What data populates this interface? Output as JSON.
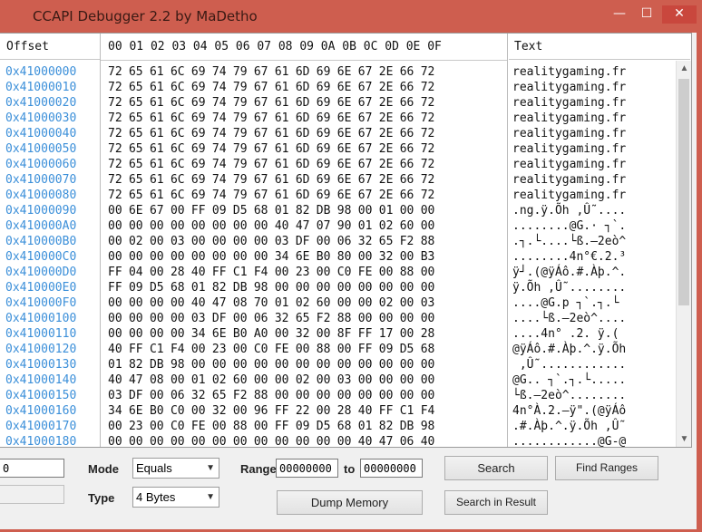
{
  "window": {
    "title": "CCAPI Debugger 2.2 by MaDetho",
    "minimize": "—",
    "maximize": "☐",
    "close": "✕"
  },
  "hex_view": {
    "headers": {
      "offset": "Offset",
      "bytes": "00 01 02 03 04 05 06 07 08 09 0A 0B 0C 0D 0E 0F",
      "text": "Text"
    },
    "rows": [
      {
        "offset": "0x41000000",
        "bytes": "72 65 61 6C 69 74 79 67 61 6D 69 6E 67 2E 66 72",
        "text": "realitygaming.fr"
      },
      {
        "offset": "0x41000010",
        "bytes": "72 65 61 6C 69 74 79 67 61 6D 69 6E 67 2E 66 72",
        "text": "realitygaming.fr"
      },
      {
        "offset": "0x41000020",
        "bytes": "72 65 61 6C 69 74 79 67 61 6D 69 6E 67 2E 66 72",
        "text": "realitygaming.fr"
      },
      {
        "offset": "0x41000030",
        "bytes": "72 65 61 6C 69 74 79 67 61 6D 69 6E 67 2E 66 72",
        "text": "realitygaming.fr"
      },
      {
        "offset": "0x41000040",
        "bytes": "72 65 61 6C 69 74 79 67 61 6D 69 6E 67 2E 66 72",
        "text": "realitygaming.fr"
      },
      {
        "offset": "0x41000050",
        "bytes": "72 65 61 6C 69 74 79 67 61 6D 69 6E 67 2E 66 72",
        "text": "realitygaming.fr"
      },
      {
        "offset": "0x41000060",
        "bytes": "72 65 61 6C 69 74 79 67 61 6D 69 6E 67 2E 66 72",
        "text": "realitygaming.fr"
      },
      {
        "offset": "0x41000070",
        "bytes": "72 65 61 6C 69 74 79 67 61 6D 69 6E 67 2E 66 72",
        "text": "realitygaming.fr"
      },
      {
        "offset": "0x41000080",
        "bytes": "72 65 61 6C 69 74 79 67 61 6D 69 6E 67 2E 66 72",
        "text": "realitygaming.fr"
      },
      {
        "offset": "0x41000090",
        "bytes": "00 6E 67 00 FF 09 D5 68 01 82 DB 98 00 01 00 00",
        "text": ".ng.ÿ.Õh ,Û˜...."
      },
      {
        "offset": "0x410000A0",
        "bytes": "00 00 00 00 00 00 00 00 40 47 07 90 01 02 60 00",
        "text": "........@G.· ┐`."
      },
      {
        "offset": "0x410000B0",
        "bytes": "00 02 00 03 00 00 00 00 03 DF 00 06 32 65 F2 88",
        "text": ".┐.└....└ß.–2eò^"
      },
      {
        "offset": "0x410000C0",
        "bytes": "00 00 00 00 00 00 00 00 34 6E B0 80 00 32 00 B3",
        "text": "........4n°€.2.³"
      },
      {
        "offset": "0x410000D0",
        "bytes": "FF 04 00 28 40 FF C1 F4 00 23 00 C0 FE 00 88 00",
        "text": "ÿ┘.(@ÿÁô.#.Àþ.^."
      },
      {
        "offset": "0x410000E0",
        "bytes": "FF 09 D5 68 01 82 DB 98 00 00 00 00 00 00 00 00",
        "text": "ÿ.Õh ,Û˜........"
      },
      {
        "offset": "0x410000F0",
        "bytes": "00 00 00 00 40 47 08 70 01 02 60 00 00 02 00 03",
        "text": "....@G.p ┐`.┐.└"
      },
      {
        "offset": "0x41000100",
        "bytes": "00 00 00 00 03 DF 00 06 32 65 F2 88 00 00 00 00",
        "text": "....└ß.–2eò^...."
      },
      {
        "offset": "0x41000110",
        "bytes": "00 00 00 00 34 6E B0 A0 00 32 00 8F FF 17 00 28",
        "text": "....4n° .2. ÿ.("
      },
      {
        "offset": "0x41000120",
        "bytes": "40 FF C1 F4 00 23 00 C0 FE 00 88 00 FF 09 D5 68",
        "text": "@ÿÁô.#.Àþ.^.ÿ.Õh"
      },
      {
        "offset": "0x41000130",
        "bytes": "01 82 DB 98 00 00 00 00 00 00 00 00 00 00 00 00",
        "text": " ,Û˜............"
      },
      {
        "offset": "0x41000140",
        "bytes": "40 47 08 00 01 02 60 00 00 02 00 03 00 00 00 00",
        "text": "@G.. ┐`.┐.└....."
      },
      {
        "offset": "0x41000150",
        "bytes": "03 DF 00 06 32 65 F2 88 00 00 00 00 00 00 00 00",
        "text": "└ß.–2eò^........"
      },
      {
        "offset": "0x41000160",
        "bytes": "34 6E B0 C0 00 32 00 96 FF 22 00 28 40 FF C1 F4",
        "text": "4n°À.2.–ÿ\".(@ÿÁô"
      },
      {
        "offset": "0x41000170",
        "bytes": "00 23 00 C0 FE 00 88 00 FF 09 D5 68 01 82 DB 98",
        "text": ".#.Àþ.^.ÿ.Õh ,Û˜"
      },
      {
        "offset": "0x41000180",
        "bytes": "00 00 00 00 00 00 00 00 00 00 00 00 40 47 06 40",
        "text": "............@G-@"
      }
    ]
  },
  "search": {
    "value_input": "0",
    "mode_label": "Mode",
    "mode_value": "Equals",
    "type_label": "Type",
    "type_value": "4 Bytes",
    "range_label": "Range",
    "range_from": "00000000",
    "to_label": "to",
    "range_to": "00000000",
    "search_button": "Search",
    "find_ranges_button": "Find Ranges",
    "dump_memory_button": "Dump Memory",
    "search_in_result_button": "Search in Result"
  }
}
